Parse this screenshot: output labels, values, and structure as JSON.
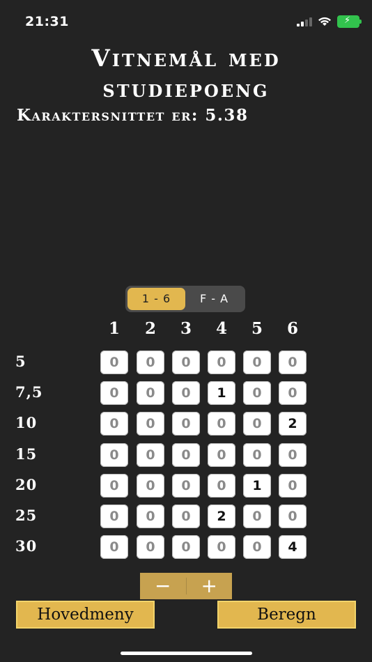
{
  "status": {
    "time": "21:31"
  },
  "header": {
    "title_line1": "Vitnemål med",
    "title_line2": "studiepoeng",
    "average_label": "Karaktersnittet er: 5.38"
  },
  "segment": {
    "options": [
      "1 - 6",
      "F - A"
    ],
    "selected": "1 - 6"
  },
  "grid": {
    "columns": [
      "1",
      "2",
      "3",
      "4",
      "5",
      "6"
    ],
    "rows": [
      {
        "label": "5",
        "values": [
          "0",
          "0",
          "0",
          "0",
          "0",
          "0"
        ]
      },
      {
        "label": "7,5",
        "values": [
          "0",
          "0",
          "0",
          "1",
          "0",
          "0"
        ]
      },
      {
        "label": "10",
        "values": [
          "0",
          "0",
          "0",
          "0",
          "0",
          "2"
        ]
      },
      {
        "label": "15",
        "values": [
          "0",
          "0",
          "0",
          "0",
          "0",
          "0"
        ]
      },
      {
        "label": "20",
        "values": [
          "0",
          "0",
          "0",
          "0",
          "1",
          "0"
        ]
      },
      {
        "label": "25",
        "values": [
          "0",
          "0",
          "0",
          "2",
          "0",
          "0"
        ]
      },
      {
        "label": "30",
        "values": [
          "0",
          "0",
          "0",
          "0",
          "0",
          "4"
        ]
      }
    ]
  },
  "stepper": {
    "minus": "−",
    "plus": "+"
  },
  "buttons": {
    "left": "Hovedmeny",
    "right": "Beregn"
  },
  "colors": {
    "accent": "#e2b74f",
    "background": "#232323"
  }
}
